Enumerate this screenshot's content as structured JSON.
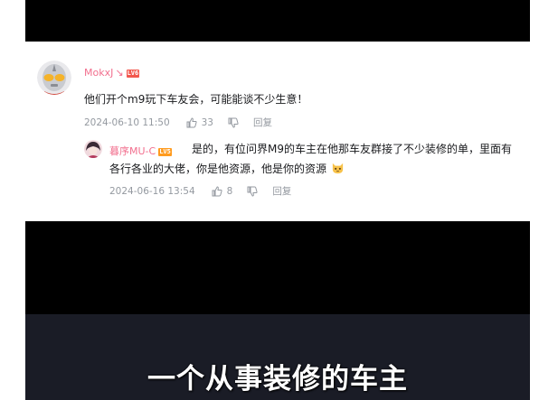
{
  "comment": {
    "username": "MokxJ",
    "level": "LV6",
    "text": "他们开个m9玩下车友会，可能能谈不少生意！",
    "date": "2024-06-10 11:50",
    "likes": "33",
    "reply_label": "回复"
  },
  "reply": {
    "username": "暮序MU-C",
    "level": "LV5",
    "text_line1": "是的，有位问界M9的车主在他那车友群接了不少装修的单，里面有",
    "text_line2": "各行各业的大佬，你是他资源，他是你的资源",
    "date": "2024-06-16 13:54",
    "likes": "8",
    "reply_label": "回复"
  },
  "video": {
    "subtitle": "一个从事装修的车主"
  },
  "colors": {
    "username": "#f26f8e",
    "meta_gray": "#9499a0",
    "level6_badge": "#f2584e",
    "level5_badge": "#ff9b1f",
    "subtitle_bg": "#1a1c26"
  },
  "icons": {
    "like": "thumb-up-icon",
    "dislike": "thumb-down-icon",
    "emoji": "cat-face-emoji-icon",
    "name_suffix": "slash-decoration-icon"
  }
}
